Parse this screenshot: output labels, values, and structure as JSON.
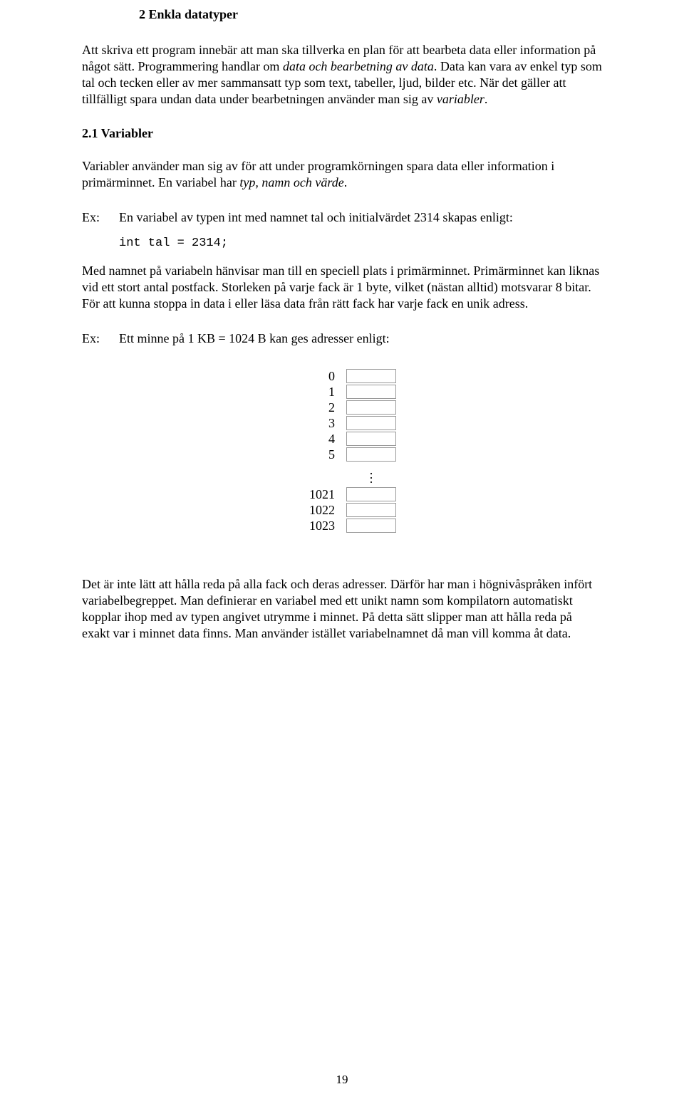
{
  "title": "2 Enkla datatyper",
  "p1": "Att skriva ett program innebär att man ska tillverka en plan för att bearbeta data eller information  på något sätt. Programmering handlar om ",
  "p1_i": "data och bearbetning av data",
  "p1_end": ". Data kan vara av enkel typ som tal och tecken eller av mer sammansatt typ som text, tabeller, ljud, bilder etc. När det gäller att tillfälligt spara undan data under bearbetningen använder man sig av ",
  "p1_i2": "variabler",
  "p1_end2": ".",
  "h2": "2.1 Variabler",
  "p2": "Variabler använder man sig av för att under programkörningen spara data eller information i primärminnet. En variabel har ",
  "p2_i": "typ, namn och värde",
  "p2_end": ".",
  "ex1_lbl": "Ex:",
  "ex1_txt": "En variabel av typen int med namnet tal och initialvärdet 2314 skapas enligt:",
  "code1": "int tal = 2314;",
  "p3": "Med namnet på variabeln hänvisar man till en speciell plats i primärminnet. Primärminnet kan liknas vid ett stort antal postfack. Storleken på varje fack är 1 byte, vilket (nästan alltid) motsvarar 8 bitar. För att kunna stoppa in data i eller läsa data från rätt fack har varje fack en unik adress.",
  "ex2_lbl": "Ex:",
  "ex2_txt": "Ett minne på 1 KB = 1024 B kan ges adresser enligt:",
  "mem_top": [
    "0",
    "1",
    "2",
    "3",
    "4",
    "5"
  ],
  "mem_bot": [
    "1021",
    "1022",
    "1023"
  ],
  "p4": "Det är inte lätt att hålla reda på alla fack och deras adresser. Därför har man i högnivåspråken infört variabelbegreppet. Man definierar en variabel med ett unikt namn som kompilatorn automatiskt kopplar ihop med av typen angivet utrymme i minnet. På detta sätt slipper man att hålla reda på exakt var i minnet data finns. Man använder istället variabelnamnet då man vill komma åt data.",
  "pagenum": "19"
}
